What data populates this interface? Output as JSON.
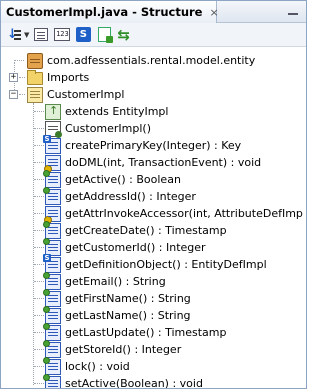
{
  "window": {
    "tab_title": "CustomerImpl.java - Structure",
    "close_glyph": "×"
  },
  "toolbar": {
    "buttons": [
      {
        "name": "sort-icon"
      },
      {
        "name": "list-view-icon"
      },
      {
        "name": "numbered-view-icon",
        "text": "123"
      },
      {
        "name": "static-filter-icon",
        "text": "S"
      },
      {
        "name": "new-document-icon"
      },
      {
        "name": "sync-icon"
      }
    ]
  },
  "tree": {
    "package": "com.adfessentials.rental.model.entity",
    "imports": "Imports",
    "class_name": "CustomerImpl",
    "extends": "extends EntityImpl",
    "members": [
      {
        "label": "CustomerImpl()",
        "icon": "constructor-icon"
      },
      {
        "label": "createPrimaryKey(Integer) : Key",
        "icon": "static-method-icon"
      },
      {
        "label": "doDML(int, TransactionEvent) : void",
        "icon": "protected-method-icon"
      },
      {
        "label": "getActive() : Boolean",
        "icon": "method-icon"
      },
      {
        "label": "getAddressId() : Integer",
        "icon": "method-icon"
      },
      {
        "label": "getAttrInvokeAccessor(int, AttributeDefImp",
        "icon": "protected-method-icon"
      },
      {
        "label": "getCreateDate() : Timestamp",
        "icon": "method-icon"
      },
      {
        "label": "getCustomerId() : Integer",
        "icon": "method-icon"
      },
      {
        "label": "getDefinitionObject() : EntityDefImpl",
        "icon": "static-method-icon"
      },
      {
        "label": "getEmail() : String",
        "icon": "method-icon"
      },
      {
        "label": "getFirstName() : String",
        "icon": "method-icon"
      },
      {
        "label": "getLastName() : String",
        "icon": "method-icon"
      },
      {
        "label": "getLastUpdate() : Timestamp",
        "icon": "method-icon"
      },
      {
        "label": "getStoreId() : Integer",
        "icon": "method-icon"
      },
      {
        "label": "lock() : void",
        "icon": "method-icon"
      },
      {
        "label": "setActive(Boolean) : void",
        "icon": "method-icon"
      }
    ]
  }
}
